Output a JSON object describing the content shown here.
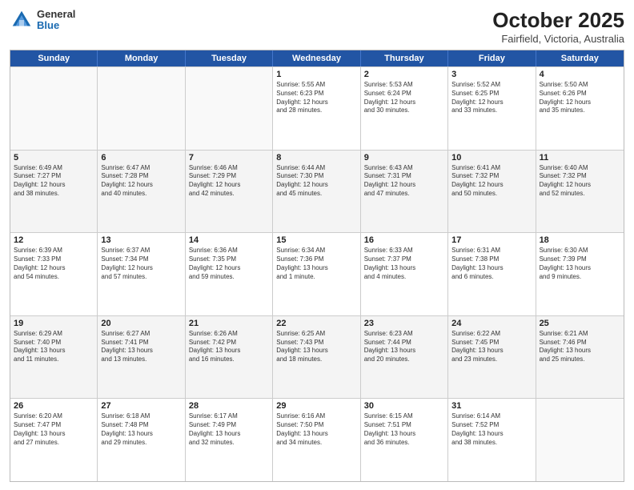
{
  "header": {
    "logo": {
      "general": "General",
      "blue": "Blue"
    },
    "title": "October 2025",
    "subtitle": "Fairfield, Victoria, Australia"
  },
  "days_of_week": [
    "Sunday",
    "Monday",
    "Tuesday",
    "Wednesday",
    "Thursday",
    "Friday",
    "Saturday"
  ],
  "weeks": [
    [
      {
        "day": "",
        "info": ""
      },
      {
        "day": "",
        "info": ""
      },
      {
        "day": "",
        "info": ""
      },
      {
        "day": "1",
        "info": "Sunrise: 5:55 AM\nSunset: 6:23 PM\nDaylight: 12 hours\nand 28 minutes."
      },
      {
        "day": "2",
        "info": "Sunrise: 5:53 AM\nSunset: 6:24 PM\nDaylight: 12 hours\nand 30 minutes."
      },
      {
        "day": "3",
        "info": "Sunrise: 5:52 AM\nSunset: 6:25 PM\nDaylight: 12 hours\nand 33 minutes."
      },
      {
        "day": "4",
        "info": "Sunrise: 5:50 AM\nSunset: 6:26 PM\nDaylight: 12 hours\nand 35 minutes."
      }
    ],
    [
      {
        "day": "5",
        "info": "Sunrise: 6:49 AM\nSunset: 7:27 PM\nDaylight: 12 hours\nand 38 minutes."
      },
      {
        "day": "6",
        "info": "Sunrise: 6:47 AM\nSunset: 7:28 PM\nDaylight: 12 hours\nand 40 minutes."
      },
      {
        "day": "7",
        "info": "Sunrise: 6:46 AM\nSunset: 7:29 PM\nDaylight: 12 hours\nand 42 minutes."
      },
      {
        "day": "8",
        "info": "Sunrise: 6:44 AM\nSunset: 7:30 PM\nDaylight: 12 hours\nand 45 minutes."
      },
      {
        "day": "9",
        "info": "Sunrise: 6:43 AM\nSunset: 7:31 PM\nDaylight: 12 hours\nand 47 minutes."
      },
      {
        "day": "10",
        "info": "Sunrise: 6:41 AM\nSunset: 7:32 PM\nDaylight: 12 hours\nand 50 minutes."
      },
      {
        "day": "11",
        "info": "Sunrise: 6:40 AM\nSunset: 7:32 PM\nDaylight: 12 hours\nand 52 minutes."
      }
    ],
    [
      {
        "day": "12",
        "info": "Sunrise: 6:39 AM\nSunset: 7:33 PM\nDaylight: 12 hours\nand 54 minutes."
      },
      {
        "day": "13",
        "info": "Sunrise: 6:37 AM\nSunset: 7:34 PM\nDaylight: 12 hours\nand 57 minutes."
      },
      {
        "day": "14",
        "info": "Sunrise: 6:36 AM\nSunset: 7:35 PM\nDaylight: 12 hours\nand 59 minutes."
      },
      {
        "day": "15",
        "info": "Sunrise: 6:34 AM\nSunset: 7:36 PM\nDaylight: 13 hours\nand 1 minute."
      },
      {
        "day": "16",
        "info": "Sunrise: 6:33 AM\nSunset: 7:37 PM\nDaylight: 13 hours\nand 4 minutes."
      },
      {
        "day": "17",
        "info": "Sunrise: 6:31 AM\nSunset: 7:38 PM\nDaylight: 13 hours\nand 6 minutes."
      },
      {
        "day": "18",
        "info": "Sunrise: 6:30 AM\nSunset: 7:39 PM\nDaylight: 13 hours\nand 9 minutes."
      }
    ],
    [
      {
        "day": "19",
        "info": "Sunrise: 6:29 AM\nSunset: 7:40 PM\nDaylight: 13 hours\nand 11 minutes."
      },
      {
        "day": "20",
        "info": "Sunrise: 6:27 AM\nSunset: 7:41 PM\nDaylight: 13 hours\nand 13 minutes."
      },
      {
        "day": "21",
        "info": "Sunrise: 6:26 AM\nSunset: 7:42 PM\nDaylight: 13 hours\nand 16 minutes."
      },
      {
        "day": "22",
        "info": "Sunrise: 6:25 AM\nSunset: 7:43 PM\nDaylight: 13 hours\nand 18 minutes."
      },
      {
        "day": "23",
        "info": "Sunrise: 6:23 AM\nSunset: 7:44 PM\nDaylight: 13 hours\nand 20 minutes."
      },
      {
        "day": "24",
        "info": "Sunrise: 6:22 AM\nSunset: 7:45 PM\nDaylight: 13 hours\nand 23 minutes."
      },
      {
        "day": "25",
        "info": "Sunrise: 6:21 AM\nSunset: 7:46 PM\nDaylight: 13 hours\nand 25 minutes."
      }
    ],
    [
      {
        "day": "26",
        "info": "Sunrise: 6:20 AM\nSunset: 7:47 PM\nDaylight: 13 hours\nand 27 minutes."
      },
      {
        "day": "27",
        "info": "Sunrise: 6:18 AM\nSunset: 7:48 PM\nDaylight: 13 hours\nand 29 minutes."
      },
      {
        "day": "28",
        "info": "Sunrise: 6:17 AM\nSunset: 7:49 PM\nDaylight: 13 hours\nand 32 minutes."
      },
      {
        "day": "29",
        "info": "Sunrise: 6:16 AM\nSunset: 7:50 PM\nDaylight: 13 hours\nand 34 minutes."
      },
      {
        "day": "30",
        "info": "Sunrise: 6:15 AM\nSunset: 7:51 PM\nDaylight: 13 hours\nand 36 minutes."
      },
      {
        "day": "31",
        "info": "Sunrise: 6:14 AM\nSunset: 7:52 PM\nDaylight: 13 hours\nand 38 minutes."
      },
      {
        "day": "",
        "info": ""
      }
    ]
  ]
}
